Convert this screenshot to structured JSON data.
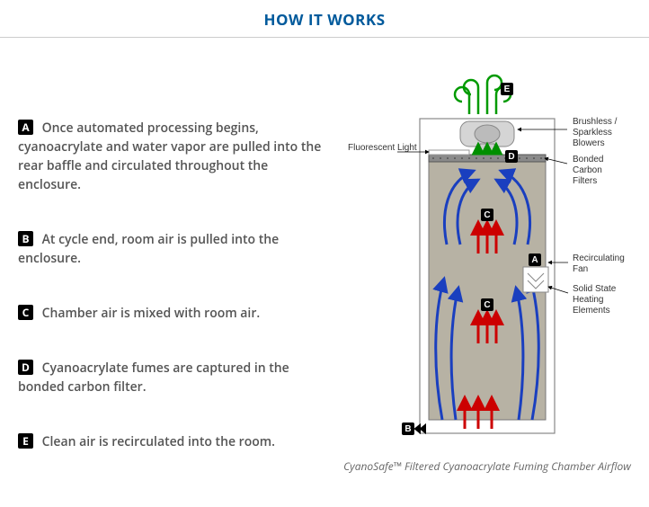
{
  "header": {
    "title": "HOW IT WORKS"
  },
  "steps": [
    {
      "badge": "A",
      "text": "Once automated processing begins, cyanoacrylate and water vapor are pulled into the rear baffle and circulated throughout the enclosure."
    },
    {
      "badge": "B",
      "text": "At cycle end, room air is pulled into the enclosure."
    },
    {
      "badge": "C",
      "text": "Chamber air is mixed with room air."
    },
    {
      "badge": "D",
      "text": "Cyanoacrylate fumes are captured in the bonded carbon filter."
    },
    {
      "badge": "E",
      "text": "Clean air is recirculated into the room."
    }
  ],
  "diagram": {
    "caption": "CyanoSafe™ Filtered Cyanoacrylate Fuming Chamber Airflow",
    "labels": {
      "fluorescent": "Fluorescent Light",
      "blowers_l1": "Brushless /",
      "blowers_l2": "Sparkless",
      "blowers_l3": "Blowers",
      "filters_l1": "Bonded",
      "filters_l2": "Carbon",
      "filters_l3": "Filters",
      "fan_l1": "Recirculating",
      "fan_l2": "Fan",
      "heat_l1": "Solid State",
      "heat_l2": "Heating",
      "heat_l3": "Elements"
    },
    "markers": {
      "A": "A",
      "B": "B",
      "C1": "C",
      "C2": "C",
      "D": "D",
      "E": "E"
    }
  }
}
